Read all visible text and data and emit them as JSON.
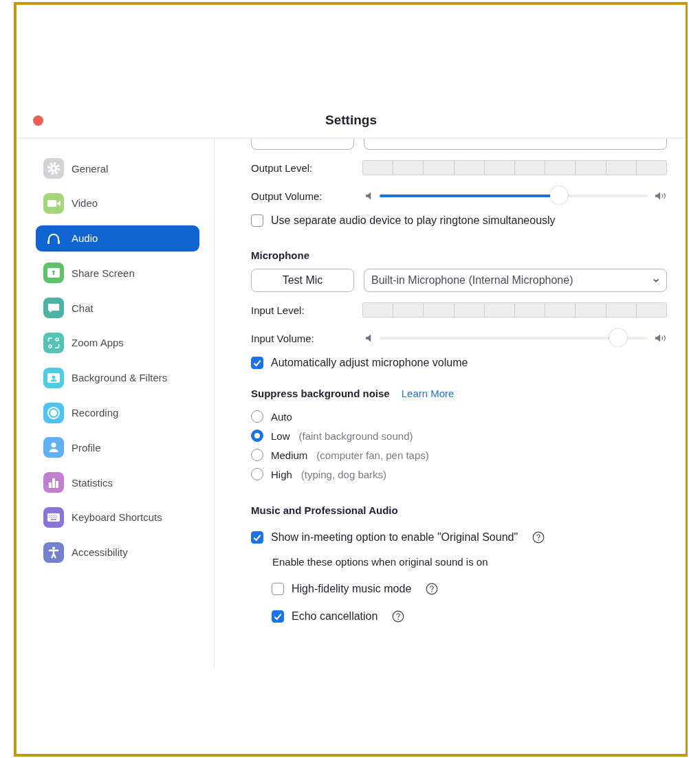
{
  "window": {
    "title": "Settings"
  },
  "sidebar": {
    "items": [
      {
        "label": "General",
        "selected": false,
        "color": "#d4d4d6"
      },
      {
        "label": "Video",
        "selected": false,
        "color": "#a6d67c"
      },
      {
        "label": "Audio",
        "selected": true,
        "color": "#0f64d2"
      },
      {
        "label": "Share Screen",
        "selected": false,
        "color": "#5fc26a"
      },
      {
        "label": "Chat",
        "selected": false,
        "color": "#4db3a4"
      },
      {
        "label": "Zoom Apps",
        "selected": false,
        "color": "#56c4b4"
      },
      {
        "label": "Background & Filters",
        "selected": false,
        "color": "#4dcde0"
      },
      {
        "label": "Recording",
        "selected": false,
        "color": "#4cc3f0"
      },
      {
        "label": "Profile",
        "selected": false,
        "color": "#60b0f4"
      },
      {
        "label": "Statistics",
        "selected": false,
        "color": "#c37fcf"
      },
      {
        "label": "Keyboard Shortcuts",
        "selected": false,
        "color": "#8b74d8"
      },
      {
        "label": "Accessibility",
        "selected": false,
        "color": "#7482cc"
      }
    ]
  },
  "speaker": {
    "output_level_label": "Output Level:",
    "output_volume_label": "Output Volume:",
    "output_volume": {
      "level": 0.67,
      "disabled": false
    },
    "separate_device": {
      "label": "Use separate audio device to play ringtone simultaneously",
      "checked": false
    }
  },
  "microphone": {
    "heading": "Microphone",
    "test_button": "Test Mic",
    "device": "Built-in Microphone (Internal Microphone)",
    "input_level_label": "Input Level:",
    "input_volume_label": "Input Volume:",
    "input_volume": {
      "level": 0.89,
      "disabled": true
    },
    "auto_adjust": {
      "label": "Automatically adjust microphone volume",
      "checked": true
    }
  },
  "noise": {
    "heading": "Suppress background noise",
    "link": "Learn More",
    "options": [
      {
        "label": "Auto",
        "selected": false
      },
      {
        "label": "Low",
        "hint": "(faint background sound)",
        "selected": true
      },
      {
        "label": "Medium",
        "hint": "(computer fan, pen taps)",
        "selected": false
      },
      {
        "label": "High",
        "hint": "(typing, dog barks)",
        "selected": false
      }
    ]
  },
  "music": {
    "heading": "Music and Professional Audio",
    "original_sound": {
      "label": "Show in-meeting option to enable \"Original Sound\"",
      "checked": true
    },
    "note": "Enable these options when original sound is on",
    "options": [
      {
        "label": "High-fidelity music mode",
        "checked": false
      },
      {
        "label": "Echo cancellation",
        "checked": true
      }
    ]
  }
}
